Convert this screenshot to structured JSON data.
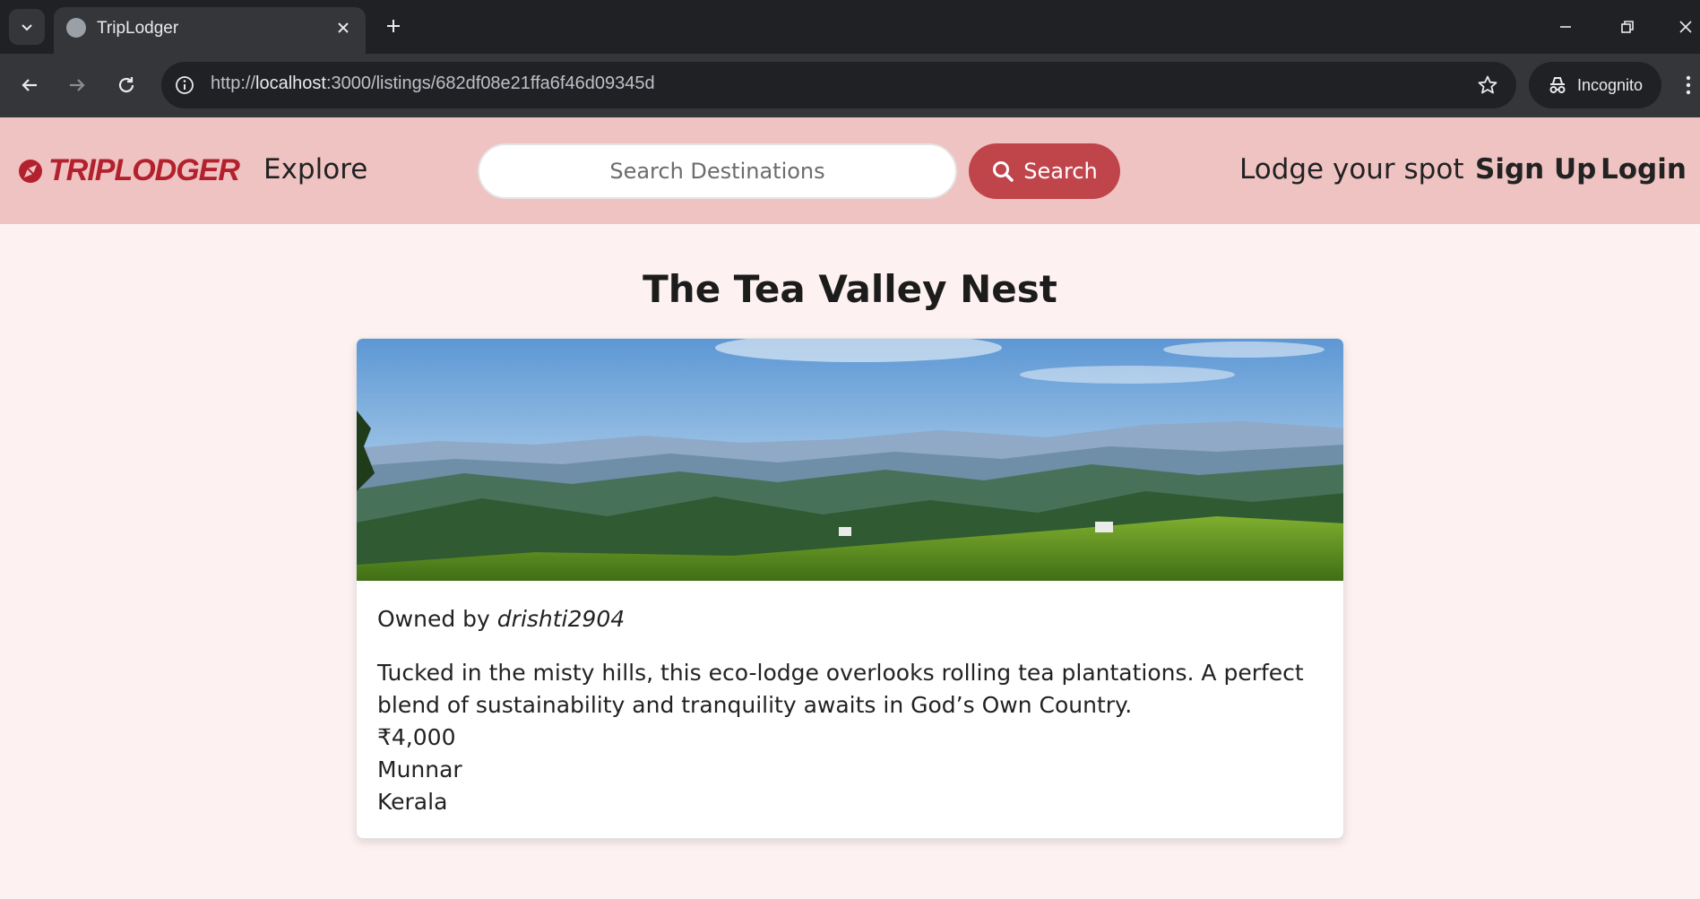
{
  "browser": {
    "tab_title": "TripLodger",
    "url_prefix": "http://",
    "url_host": "localhost",
    "url_rest": ":3000/listings/682df08e21ffa6f46d09345d",
    "incognito_label": "Incognito"
  },
  "navbar": {
    "brand": "TRIPLODGER",
    "explore": "Explore",
    "search_placeholder": "Search Destinations",
    "search_button": "Search",
    "lodge": "Lodge your spot",
    "signup": "Sign Up",
    "login": "Login"
  },
  "listing": {
    "title": "The Tea Valley Nest",
    "owner_prefix": "Owned by",
    "owner_name": "drishti2904",
    "description": "Tucked in the misty hills, this eco-lodge overlooks rolling tea plantations. A perfect blend of sustainability and tranquility awaits in God’s Own Country.",
    "price": "₹4,000",
    "location": "Munnar",
    "state": "Kerala"
  },
  "colors": {
    "navbar_bg": "#f0c3c3",
    "brand": "#b2212d",
    "search_button": "#c0454b",
    "page_bg": "#fef1f1"
  }
}
